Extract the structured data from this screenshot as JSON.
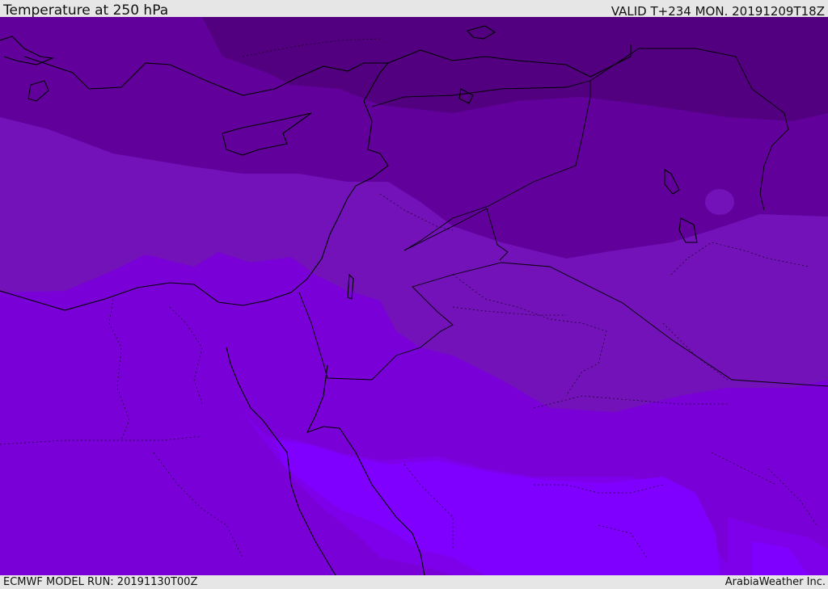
{
  "header": {
    "title": "Temperature at 250 hPa",
    "valid": "VALID T+234 MON. 20191209T18Z"
  },
  "footer": {
    "model_run": "ECMWF MODEL RUN: 20191130T00Z",
    "credit": "ArabiaWeather Inc."
  },
  "map": {
    "colors": {
      "darkest": "#520080",
      "dark": "#62009c",
      "mid": "#7212b8",
      "light": "#7a00d8",
      "brighter": "#7e00ea",
      "brightest": "#8000ff",
      "coast": "#000000",
      "border": "#000000"
    }
  }
}
